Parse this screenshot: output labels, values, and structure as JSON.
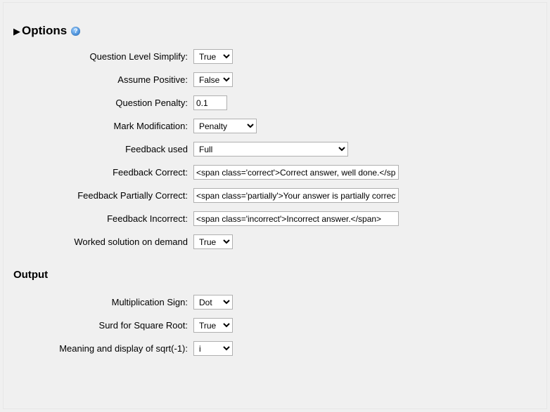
{
  "sections": {
    "options": {
      "title": "Options",
      "help_glyph": "?",
      "fields": {
        "simplify": {
          "label": "Question Level Simplify:",
          "value": "True"
        },
        "assume_pos": {
          "label": "Assume Positive:",
          "value": "False"
        },
        "penalty": {
          "label": "Question Penalty:",
          "value": "0.1"
        },
        "mark_mod": {
          "label": "Mark Modification:",
          "value": "Penalty"
        },
        "feedback_used": {
          "label": "Feedback used",
          "value": "Full"
        },
        "fb_correct": {
          "label": "Feedback Correct:",
          "value": "<span class='correct'>Correct answer, well done.</span>"
        },
        "fb_partial": {
          "label": "Feedback Partially Correct:",
          "value": "<span class='partially'>Your answer is partially correct."
        },
        "fb_incorrect": {
          "label": "Feedback Incorrect:",
          "value": "<span class='incorrect'>Incorrect answer.</span>"
        },
        "worked": {
          "label": "Worked solution on demand",
          "value": "True"
        }
      }
    },
    "output": {
      "title": "Output",
      "fields": {
        "mult_sign": {
          "label": "Multiplication Sign:",
          "value": "Dot"
        },
        "surd": {
          "label": "Surd for Square Root:",
          "value": "True"
        },
        "sqrt_neg1": {
          "label": "Meaning and display of sqrt(-1):",
          "value": "i"
        }
      }
    }
  }
}
